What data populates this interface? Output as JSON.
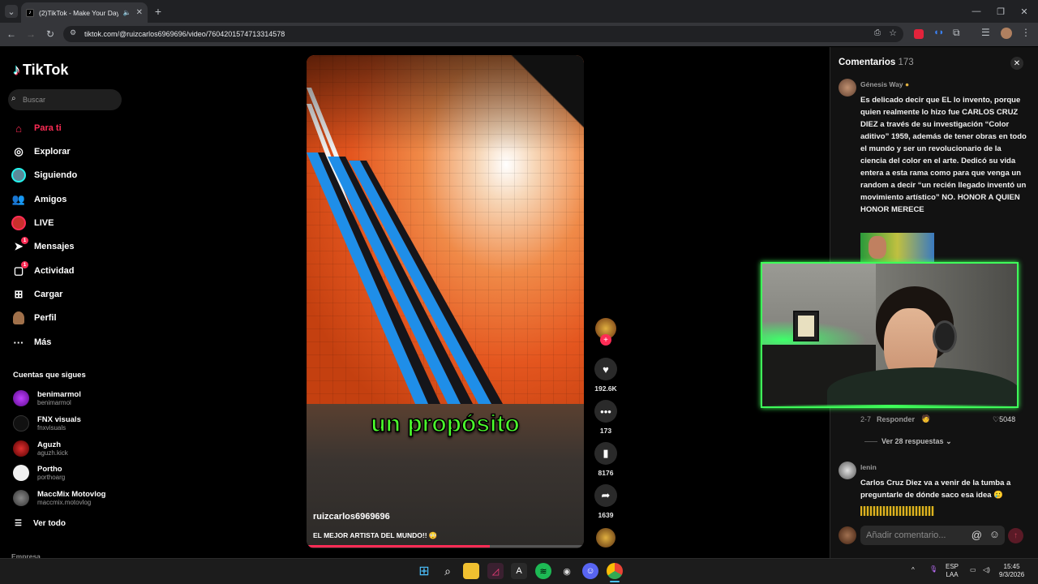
{
  "browser": {
    "tab_title": "(2)TikTok - Make Your Day",
    "url": "tiktok.com/@ruizcarlos6969696/video/7604201574713314578"
  },
  "sidebar": {
    "brand": "TikTok",
    "search_placeholder": "Buscar",
    "nav": [
      {
        "label": "Para ti",
        "icon": "home-icon",
        "active": true
      },
      {
        "label": "Explorar",
        "icon": "compass-icon"
      },
      {
        "label": "Siguiendo",
        "icon": "following-avatar-icon"
      },
      {
        "label": "Amigos",
        "icon": "friends-icon"
      },
      {
        "label": "LIVE",
        "icon": "live-icon"
      },
      {
        "label": "Mensajes",
        "icon": "send-icon",
        "badge": "1"
      },
      {
        "label": "Actividad",
        "icon": "activity-icon",
        "badge": "1"
      },
      {
        "label": "Cargar",
        "icon": "upload-icon"
      },
      {
        "label": "Perfil",
        "icon": "profile-avatar-icon"
      },
      {
        "label": "Más",
        "icon": "more-icon"
      }
    ],
    "following_title": "Cuentas que sigues",
    "following": [
      {
        "name": "benimarmol",
        "handle": "benimarmol"
      },
      {
        "name": "FNX visuals",
        "handle": "fnxvisuals"
      },
      {
        "name": "Aguzh",
        "handle": "aguzh.kick"
      },
      {
        "name": "Portho",
        "handle": "porthoarg"
      },
      {
        "name": "MaccMix Motovlog",
        "handle": "maccmix.motovlog"
      }
    ],
    "see_all": "Ver todo",
    "footer": "Empresa"
  },
  "video": {
    "overlay_caption": "un propósito",
    "author": "ruizcarlos6969696",
    "description": "EL MEJOR ARTISTA DEL MUNDO!! 😳",
    "progress": 0.66,
    "likes": "192.6K",
    "comments": "173",
    "saves": "8176",
    "shares": "1639"
  },
  "comments": {
    "title": "Comentarios",
    "count": "173",
    "items": [
      {
        "user": "Génesis Way",
        "text": "Es delicado decir que EL lo invento, porque quien realmente lo hizo fue CARLOS CRUZ DIEZ a través de su investigación “Color aditivo” 1959, además de tener obras en todo el mundo y ser un revolucionario de la ciencia del color en el arte. Dedicó su vida entera a esta rama como para que venga un random a decir “un recién llegado inventó un movimiento artístico” NO. HONOR A QUIEN HONOR MERECE",
        "date": "2-7",
        "reply": "Responder",
        "likes": "5048",
        "replies": "Ver 28 respuestas"
      },
      {
        "user": "lenin",
        "text": "Carlos Cruz Diez va a venir de la tumba a preguntarle de dónde saco esa idea 🥲"
      }
    ],
    "input_placeholder": "Añadir comentario..."
  },
  "taskbar": {
    "lang": "ESP",
    "lang_sub": "LAA",
    "time": "15:45",
    "date": "9/3/2026"
  }
}
